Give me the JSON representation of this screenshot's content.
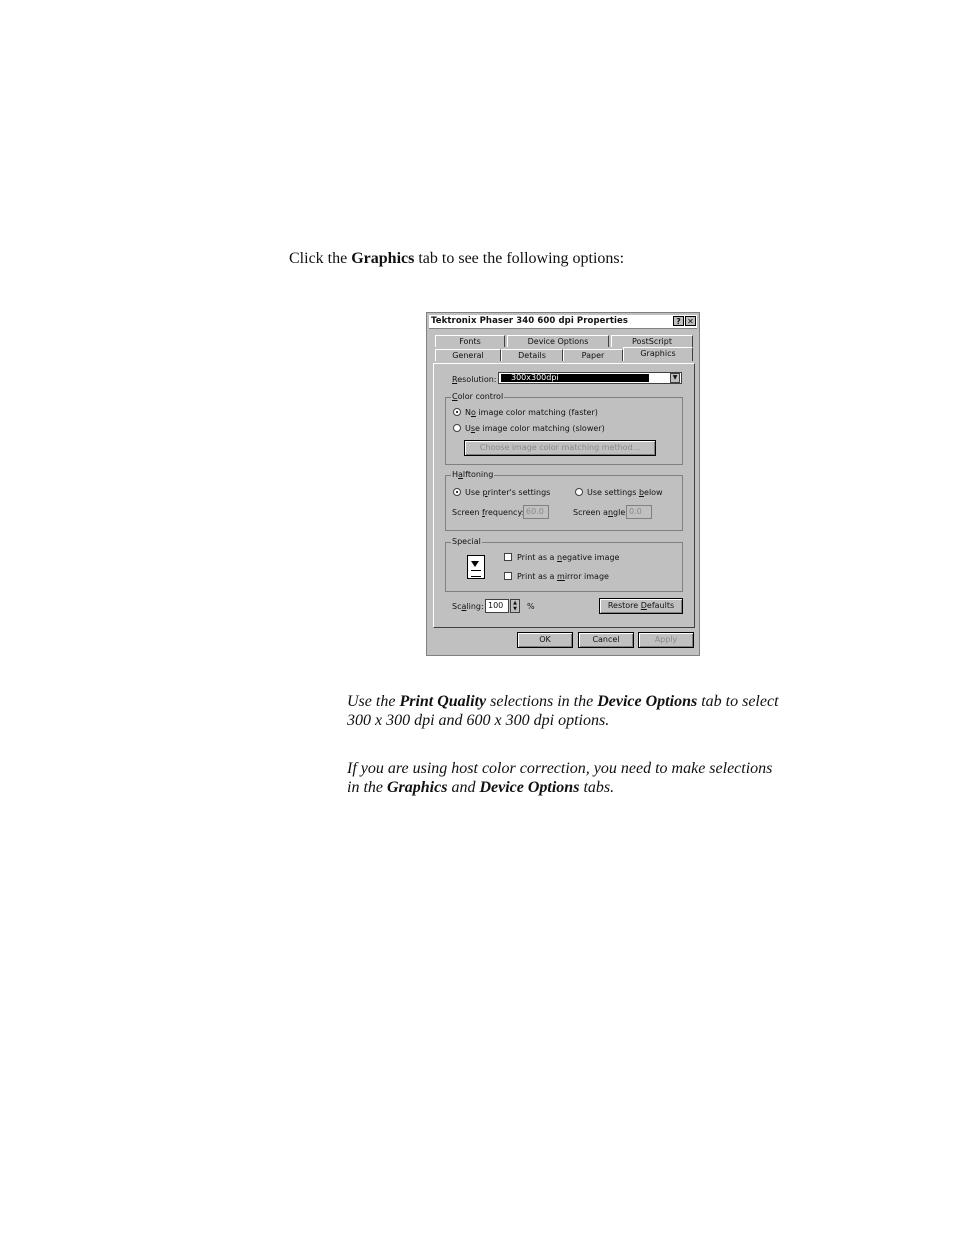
{
  "intro": {
    "pre": "Click the ",
    "bold": "Graphics",
    "post": " tab to see the following options:"
  },
  "dialog": {
    "title": "Tektronix Phaser 340 600 dpi Properties",
    "help_label": "?",
    "close_label": "✕",
    "tabs_back": [
      "Fonts",
      "Device Options",
      "PostScript"
    ],
    "tabs_front": [
      "General",
      "Details",
      "Paper",
      "Graphics"
    ],
    "resolution_label_u": "R",
    "resolution_label_rest": "esolution:",
    "resolution_value": "300x300dpi",
    "color_control": {
      "label_u": "C",
      "label_rest": "olor control",
      "opt1_pre": "N",
      "opt1_u": "o",
      "opt1_rest": " image color matching (faster)",
      "opt2_pre": "U",
      "opt2_u": "s",
      "opt2_rest": "e image color matching (slower)",
      "choose_button": "Choose image color matching method..."
    },
    "halftoning": {
      "label_pre": "H",
      "label_u": "a",
      "label_rest": "lftoning",
      "opt1_pre": "Use ",
      "opt1_u": "p",
      "opt1_rest": "rinter's settings",
      "opt2_pre": "Use settings ",
      "opt2_u": "b",
      "opt2_rest": "elow",
      "freq_label_pre": "Screen ",
      "freq_label_u": "f",
      "freq_label_rest": "requency:",
      "freq_value": "60.0",
      "angle_label_pre": "Screen a",
      "angle_label_u": "n",
      "angle_label_rest": "gle:",
      "angle_value": "0.0"
    },
    "special": {
      "label": "Special",
      "check1_pre": "Print as a ",
      "check1_u": "n",
      "check1_rest": "egative image",
      "check2_pre": "Print as a ",
      "check2_u": "m",
      "check2_rest": "irror image"
    },
    "scaling_pre": "Sc",
    "scaling_u": "a",
    "scaling_rest": "ling:",
    "scaling_value": "100",
    "percent": "%",
    "restore_pre": "Restore ",
    "restore_u": "D",
    "restore_rest": "efaults",
    "ok": "OK",
    "cancel": "Cancel",
    "apply": "Apply"
  },
  "note1": {
    "a": "Use the ",
    "b": "Print Quality",
    "c": " selections in the ",
    "d": "Device Options",
    "e": " tab to select 300 x 300 dpi and 600 x 300 dpi options."
  },
  "note2": {
    "a": "If you are using host color correction, you need to make selections in the ",
    "b": "Graphics",
    "c": " and ",
    "d": "Device Options",
    "e": " tabs."
  }
}
